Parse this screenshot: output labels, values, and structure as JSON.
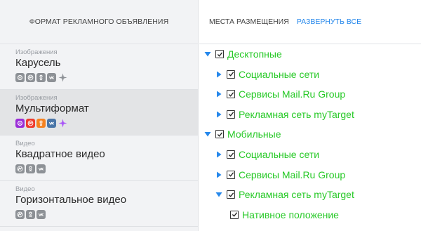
{
  "left_panel": {
    "header": "ФОРМАТ РЕКЛАМНОГО ОБЪЯВЛЕНИЯ",
    "formats": [
      {
        "category": "Изображения",
        "name": "Карусель",
        "active": false,
        "platforms": [
          "mail-icon",
          "odnoklassniki-icon",
          "ok-person-icon",
          "vk-icon",
          "sparkle-icon"
        ]
      },
      {
        "category": "Изображения",
        "name": "Мультиформат",
        "active": true,
        "platforms": [
          "mail-icon",
          "odnoklassniki-icon",
          "ok-person-icon",
          "vk-icon",
          "sparkle-icon"
        ]
      },
      {
        "category": "Видео",
        "name": "Квадратное видео",
        "active": false,
        "platforms": [
          "odnoklassniki-icon",
          "ok-person-icon",
          "vk-icon"
        ]
      },
      {
        "category": "Видео",
        "name": "Горизонтальное видео",
        "active": false,
        "platforms": [
          "odnoklassniki-icon",
          "ok-person-icon",
          "vk-icon"
        ]
      }
    ]
  },
  "right_panel": {
    "header_title": "МЕСТА РАЗМЕЩЕНИЯ",
    "expand_all_label": "РАЗВЕРНУТЬ ВСЕ",
    "tree": [
      {
        "label": "Десктопные",
        "level": 0,
        "expanded": true,
        "checked": true
      },
      {
        "label": "Социальные сети",
        "level": 1,
        "expanded": false,
        "checked": true
      },
      {
        "label": "Сервисы Mail.Ru Group",
        "level": 1,
        "expanded": false,
        "checked": true
      },
      {
        "label": "Рекламная сеть myTarget",
        "level": 1,
        "expanded": false,
        "checked": true
      },
      {
        "label": "Мобильные",
        "level": 0,
        "expanded": true,
        "checked": true
      },
      {
        "label": "Социальные сети",
        "level": 1,
        "expanded": false,
        "checked": true
      },
      {
        "label": "Сервисы Mail.Ru Group",
        "level": 1,
        "expanded": false,
        "checked": true
      },
      {
        "label": "Рекламная сеть myTarget",
        "level": 1,
        "expanded": true,
        "checked": true
      },
      {
        "label": "Нативное положение",
        "level": 2,
        "leaf": true,
        "checked": true
      }
    ]
  },
  "colors": {
    "accent_link": "#2688eb",
    "tree_label": "#27c927",
    "expander": "#2688eb",
    "inactive_icon": "#8d9196",
    "active_mail": "#9b2dd8",
    "active_odnoklassniki": "#ee3b2c",
    "active_ok_person": "#f58220",
    "active_vk": "#4a76a8",
    "active_sparkle": "#a855f7"
  }
}
